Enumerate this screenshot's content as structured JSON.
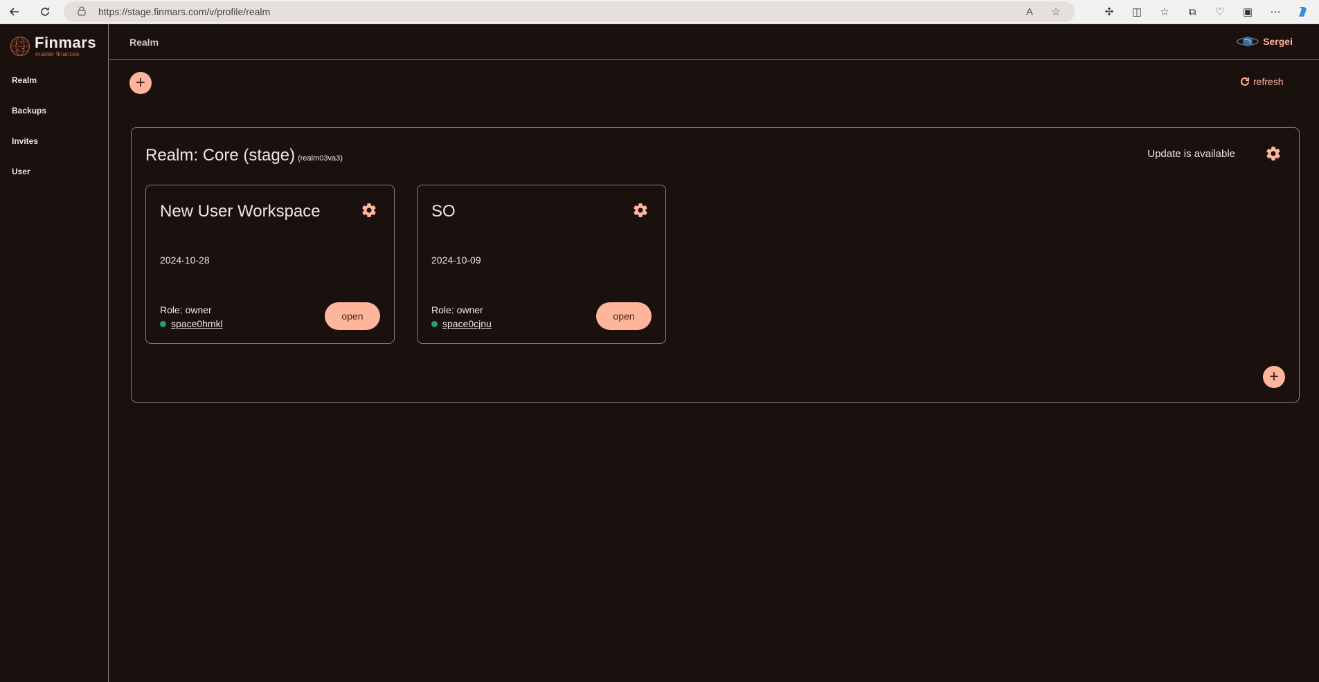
{
  "browser": {
    "url": "https://stage.finmars.com/v/profile/realm"
  },
  "logo": {
    "name": "Finmars",
    "tagline": "master finances"
  },
  "sidebar": {
    "items": [
      {
        "label": "Realm"
      },
      {
        "label": "Backups"
      },
      {
        "label": "Invites"
      },
      {
        "label": "User"
      }
    ]
  },
  "header": {
    "title": "Realm",
    "user_name": "Sergei"
  },
  "main": {
    "add_label": "+",
    "refresh_label": "refresh",
    "realm": {
      "title": "Realm: Core (stage)",
      "id": "(realm03va3)",
      "update_text": "Update is available",
      "workspaces": [
        {
          "name": "New User Workspace",
          "date": "2024-10-28",
          "role": "Role: owner",
          "space": "space0hmkl",
          "open_label": "open"
        },
        {
          "name": "SO",
          "date": "2024-10-09",
          "role": "Role: owner",
          "space": "space0cjnu",
          "open_label": "open"
        }
      ]
    }
  },
  "colors": {
    "background": "#1a100e",
    "accent": "#ffb59c",
    "border": "#8a7f7c",
    "status_online": "#1fa36b"
  }
}
